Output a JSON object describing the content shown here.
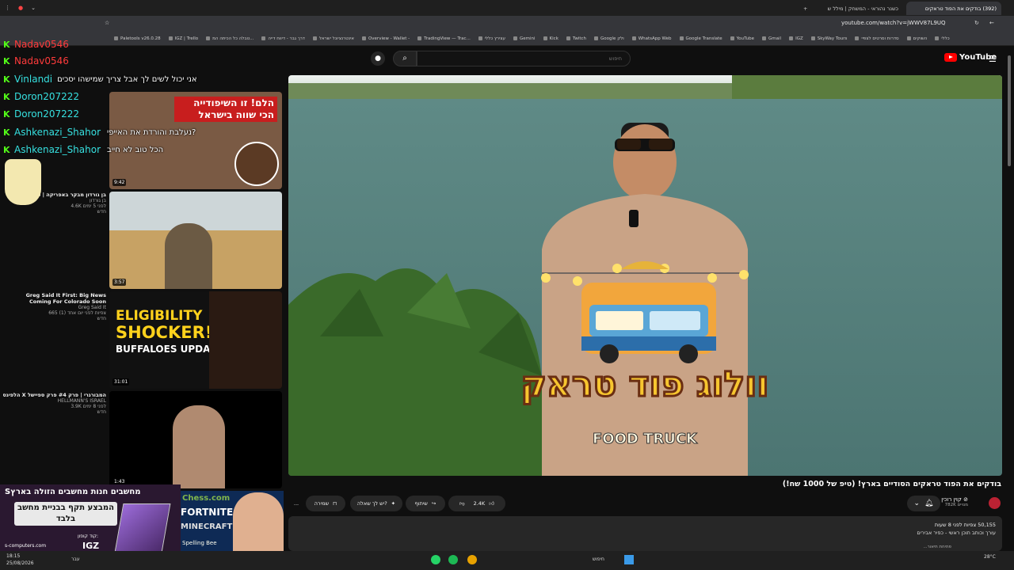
{
  "browser": {
    "tabs": [
      {
        "label": "(392) בודקים את הפוד טראקים",
        "active": true
      },
      {
        "label": "כשנר נהוראי - המשחק | מילל ש",
        "active": false
      }
    ],
    "url": "youtube.com/watch?v=jWWV87L9UQ",
    "bookmarks": [
      "Paletools v26.0.28",
      "IGZ | Trello",
      "טבלה כל הכיתה המ...",
      "דרך גבר - דיווח דייה",
      "אינטרנציונל ישראל",
      "Overview - Wallet -",
      "TradingView — Trac...",
      "עצירץ כללי",
      "Gemini",
      "Kick",
      "Twitch",
      "Google ולק",
      "WhatsApp Web",
      "Google Translate",
      "YouTube",
      "Gmail",
      "IGZ",
      "SkyWay Tours",
      "סדרות וסרטים לצפיי",
      "השוקים",
      "כללי"
    ]
  },
  "youtube": {
    "search_placeholder": "חיפוש",
    "search_value": "",
    "logo_text": "YouTube"
  },
  "video": {
    "title": "בודקים את הפוד טראקים הסודיים בארץ! (טיפ של 1000 שח!)",
    "overlay_title_he": "וולוג פוד טראק",
    "overlay_title_en": "FOOD TRUCK",
    "channel_name": "קוין רוכין ⊘",
    "subscribers": "782K מנויים",
    "likes": "2.4K",
    "share_label": "שיתוף",
    "ask_label": "יש לך שאלה?",
    "save_label": "שמירה",
    "more_label": "...",
    "views": "50,155 צפיות  לפני 8 שעות",
    "desc_line2": "עורך וכותב תוכן ראשי - כפיר אבירים",
    "desc_more": "פתיחת תיאור..."
  },
  "chat": [
    {
      "user": "Nadav0546",
      "text": "",
      "color": "#ff3b3b"
    },
    {
      "user": "Nadav0546",
      "text": "",
      "color": "#ff3b3b"
    },
    {
      "user": "Vinlandi",
      "text": "אני יכול לשים לך אבל צריך שמישהו יסכים",
      "color": "#36e0e0"
    },
    {
      "user": "Doron207222",
      "text": "",
      "color": "#36e0e0"
    },
    {
      "user": "Doron207222",
      "text": "",
      "color": "#36e0e0"
    },
    {
      "user": "Ashkenazi_Shahor",
      "text": "נעלבת והורדת את האייפי?",
      "color": "#36e0e0"
    },
    {
      "user": "Ashkenazi_Shahor",
      "text": "הכל טוב לא חייב",
      "color": "#36e0e0"
    }
  ],
  "related": [
    {
      "title": "הלם! זו השיפודייה הכי שווה בישראל",
      "duration": "9:42",
      "meta": ""
    },
    {
      "title": "בן גורדון מבקר באפריקה | פרק",
      "channel": "בן גורדון",
      "meta": "4.6K  לפני 5 ימים",
      "badge": "חדש",
      "duration": "3:57"
    },
    {
      "title": "Greg Said It First:  Big News Coming For Colorado Soon",
      "channel": "Greg Said It",
      "meta": "665  צפיות לפני יום אחד (1)",
      "badge": "חדש",
      "duration": "31:01",
      "thumb_l1": "ELIGIBILITY",
      "thumb_l2": "SHOCKER!",
      "thumb_l3": "BUFFALOES UPDATE"
    },
    {
      "title": "הלפיגס X המבורגרי | פרק #4 פרק ספיישל",
      "channel": "HELLMANN'S ISRAEL",
      "meta": "3.9K  לפני 8 ימים",
      "badge": "חדש",
      "duration": "1:43"
    }
  ],
  "promo": {
    "title": "חנות מחשבים הזולה בארץ",
    "brand": "Sמחשבים",
    "subtitle": "המבצע תקף בבניית מחשב בלבד",
    "code_label": "קוד קופון:",
    "code": "IGZ",
    "site": "s-computers.com",
    "chess": "Chess.com",
    "fortnite": "FORTNITE",
    "minecraft": "MINECRAFT",
    "spelling": "Spelling Bee"
  },
  "taskbar": {
    "search": "חיפוש",
    "time": "18:15",
    "date": "25/08/2026",
    "weather": "28°C",
    "lang": "עבר"
  }
}
